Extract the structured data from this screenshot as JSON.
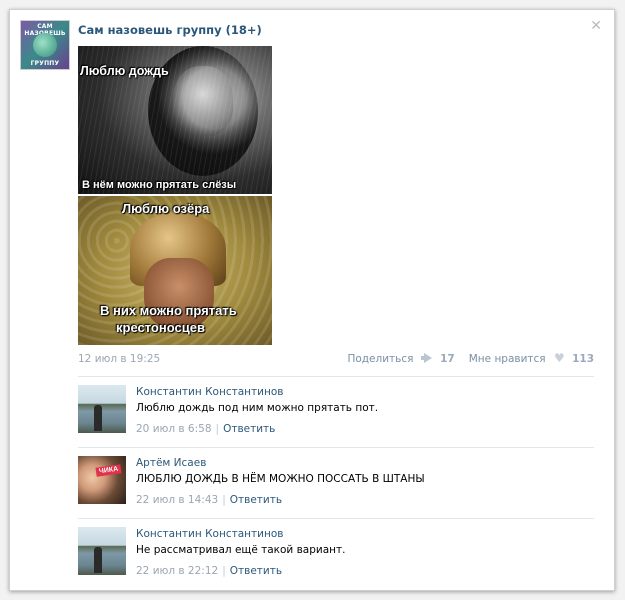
{
  "group": {
    "name": "Сам назовешь группу (18+)",
    "logo_text_top": "САМ НАЗОВЕШЬ",
    "logo_text_bottom": "ГРУППУ"
  },
  "post": {
    "image1_top": "Люблю дождь",
    "image1_bottom": "В нём можно прятать слёзы",
    "image2_top": "Люблю озёра",
    "image2_bottom_line1": "В них можно прятать",
    "image2_bottom_line2": "крестоносцев",
    "date": "12 июл в 19:25",
    "share_label": "Поделиться",
    "share_count": "17",
    "like_label": "Мне нравится",
    "like_count": "113"
  },
  "comments": [
    {
      "author": "Константин Константинов",
      "text": "Люблю дождь под ним можно прятать пот.",
      "time": "20 июл в 6:58",
      "reply_label": "Ответить"
    },
    {
      "author": "Артём Исаев",
      "text": "ЛЮБЛЮ ДОЖДЬ В НЁМ МОЖНО ПОССАТЬ В ШТАНЫ",
      "time": "22 июл в 14:43",
      "reply_label": "Ответить",
      "avatar_badge": "ЧИКА"
    },
    {
      "author": "Константин Константинов",
      "text": "Не рассматривал ещё такой вариант.",
      "time": "22 июл в 22:12",
      "reply_label": "Ответить"
    }
  ],
  "icons": {
    "close": "close-icon",
    "share": "megaphone-icon",
    "like": "heart-icon"
  }
}
